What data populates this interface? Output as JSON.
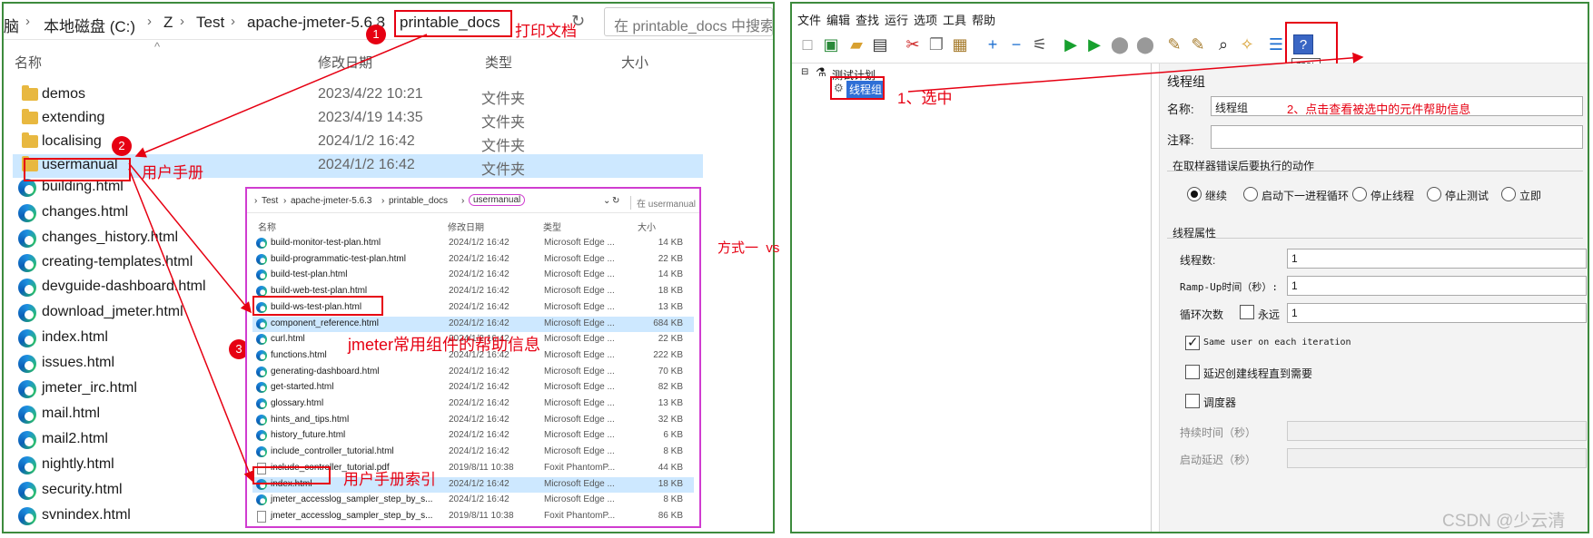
{
  "left": {
    "breadcrumb": {
      "c0": "脑",
      "c1": "本地磁盘 (C:)",
      "c2": "Z",
      "c3": "Test",
      "c4": "apache-jmeter-5.6.3",
      "c5": "printable_docs"
    },
    "search_placeholder": "在 printable_docs 中搜索",
    "refresh_icon": "↻",
    "sort_caret": "^",
    "columns": {
      "name": "名称",
      "date": "修改日期",
      "type": "类型",
      "size": "大小"
    },
    "rows": [
      {
        "name": "demos",
        "date": "2023/4/22 10:21",
        "type": "文件夹"
      },
      {
        "name": "extending",
        "date": "2023/4/19 14:35",
        "type": "文件夹"
      },
      {
        "name": "localising",
        "date": "2024/1/2 16:42",
        "type": "文件夹"
      },
      {
        "name": "usermanual",
        "date": "2024/1/2 16:42",
        "type": "文件夹"
      },
      {
        "name": "building.html"
      },
      {
        "name": "changes.html"
      },
      {
        "name": "changes_history.html"
      },
      {
        "name": "creating-templates.html"
      },
      {
        "name": "devguide-dashboard.html"
      },
      {
        "name": "download_jmeter.html"
      },
      {
        "name": "index.html"
      },
      {
        "name": "issues.html"
      },
      {
        "name": "jmeter_irc.html"
      },
      {
        "name": "mail.html"
      },
      {
        "name": "mail2.html"
      },
      {
        "name": "nightly.html"
      },
      {
        "name": "security.html"
      },
      {
        "name": "svnindex.html"
      }
    ],
    "annotations": {
      "print_docs": "打印文档",
      "user_manual": "用户手册",
      "component_help": "jmeter常用组件的帮助信息",
      "manual_index": "用户手册索引",
      "badge1": "1",
      "badge2": "2",
      "badge3": "3"
    },
    "inner": {
      "breadcrumb": {
        "c0": "Test",
        "c1": "apache-jmeter-5.6.3",
        "c2": "printable_docs",
        "c3": "usermanual"
      },
      "search_placeholder": "在 usermanual",
      "columns": {
        "name": "名称",
        "date": "修改日期",
        "type": "类型",
        "size": "大小"
      },
      "rows": [
        {
          "name": "build-monitor-test-plan.html",
          "date": "2024/1/2 16:42",
          "type": "Microsoft Edge ...",
          "size": "14 KB"
        },
        {
          "name": "build-programmatic-test-plan.html",
          "date": "2024/1/2 16:42",
          "type": "Microsoft Edge ...",
          "size": "22 KB"
        },
        {
          "name": "build-test-plan.html",
          "date": "2024/1/2 16:42",
          "type": "Microsoft Edge ...",
          "size": "14 KB"
        },
        {
          "name": "build-web-test-plan.html",
          "date": "2024/1/2 16:42",
          "type": "Microsoft Edge ...",
          "size": "18 KB"
        },
        {
          "name": "build-ws-test-plan.html",
          "date": "2024/1/2 16:42",
          "type": "Microsoft Edge ...",
          "size": "13 KB"
        },
        {
          "name": "component_reference.html",
          "date": "2024/1/2 16:42",
          "type": "Microsoft Edge ...",
          "size": "684 KB"
        },
        {
          "name": "curl.html",
          "date": "2024/1/2 16:42",
          "type": "Microsoft Edge ...",
          "size": "22 KB"
        },
        {
          "name": "functions.html",
          "date": "2024/1/2 16:42",
          "type": "Microsoft Edge ...",
          "size": "222 KB"
        },
        {
          "name": "generating-dashboard.html",
          "date": "2024/1/2 16:42",
          "type": "Microsoft Edge ...",
          "size": "70 KB"
        },
        {
          "name": "get-started.html",
          "date": "2024/1/2 16:42",
          "type": "Microsoft Edge ...",
          "size": "82 KB"
        },
        {
          "name": "glossary.html",
          "date": "2024/1/2 16:42",
          "type": "Microsoft Edge ...",
          "size": "13 KB"
        },
        {
          "name": "hints_and_tips.html",
          "date": "2024/1/2 16:42",
          "type": "Microsoft Edge ...",
          "size": "32 KB"
        },
        {
          "name": "history_future.html",
          "date": "2024/1/2 16:42",
          "type": "Microsoft Edge ...",
          "size": "6 KB"
        },
        {
          "name": "include_controller_tutorial.html",
          "date": "2024/1/2 16:42",
          "type": "Microsoft Edge ...",
          "size": "8 KB"
        },
        {
          "name": "include_controller_tutorial.pdf",
          "date": "2019/8/11 10:38",
          "type": "Foxit PhantomP...",
          "size": "44 KB"
        },
        {
          "name": "index.html",
          "date": "2024/1/2 16:42",
          "type": "Microsoft Edge ...",
          "size": "18 KB"
        },
        {
          "name": "jmeter_accesslog_sampler_step_by_s...",
          "date": "2024/1/2 16:42",
          "type": "Microsoft Edge ...",
          "size": "8 KB"
        },
        {
          "name": "jmeter_accesslog_sampler_step_by_s...",
          "date": "2019/8/11 10:38",
          "type": "Foxit PhantomP...",
          "size": "86 KB"
        }
      ]
    }
  },
  "middle": {
    "text": "方式一  vs   方式二 (第二种查看方式方便)"
  },
  "right": {
    "menu": [
      "文件",
      "编辑",
      "查找",
      "运行",
      "选项",
      "工具",
      "帮助"
    ],
    "help_tooltip": "帮助",
    "tree": {
      "root": "测试计划",
      "child": "线程组"
    },
    "annotations": {
      "select": "1、选中",
      "click_help": "2、点击查看被选中的元件帮助信息"
    },
    "form": {
      "title": "线程组",
      "name_label": "名称:",
      "name_value": "线程组",
      "comment_label": "注释:",
      "on_error_title": "在取样器错误后要执行的动作",
      "radios": [
        "继续",
        "启动下一进程循环",
        "停止线程",
        "停止测试",
        "立即"
      ],
      "props_title": "线程属性",
      "threads_label": "线程数:",
      "threads_value": "1",
      "rampup_label": "Ramp-Up时间（秒）:",
      "rampup_value": "1",
      "loop_label": "循环次数",
      "forever_label": "永远",
      "loop_value": "1",
      "same_user_label": "Same user on each iteration",
      "delay_label": "延迟创建线程直到需要",
      "scheduler_label": "调度器",
      "duration_label": "持续时间（秒）",
      "startup_delay_label": "启动延迟（秒）"
    },
    "watermark": "CSDN @少云清"
  }
}
